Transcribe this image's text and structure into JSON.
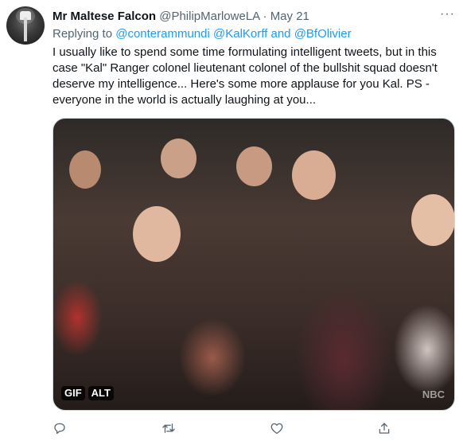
{
  "tweet": {
    "author_name": "Mr Maltese Falcon",
    "author_handle": "@PhilipMarloweLA",
    "separator": "·",
    "date": "May 21",
    "more_label": "···",
    "reply_prefix": "Replying to",
    "reply_mentions": [
      "@conterammundi",
      "@KalKorff"
    ],
    "reply_and": "and",
    "reply_last_mention": "@BfOlivier",
    "text": "I usually like to spend some time formulating intelligent tweets, but in this case \"Kal\" Ranger colonel lieutenant colonel of the bullshit squad doesn't deserve my intelligence...  Here's some more applause for you Kal. PS - everyone in the world is actually laughing at you...",
    "media": {
      "gif_badge": "GIF",
      "alt_badge": "ALT",
      "watermark": "NBC"
    }
  },
  "actions": {
    "icons": [
      "reply-icon",
      "retweet-icon",
      "like-icon",
      "share-icon"
    ]
  },
  "colors": {
    "link": "#1d9bf0",
    "muted": "#536471",
    "text": "#0f1419"
  }
}
